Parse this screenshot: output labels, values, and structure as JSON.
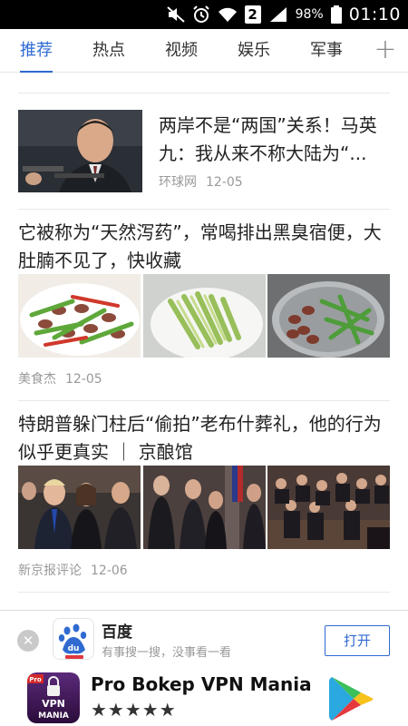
{
  "status_bar": {
    "battery": "98%",
    "time": "01:10",
    "notification_badge": "2"
  },
  "tabs": [
    {
      "label": "推荐",
      "active": true
    },
    {
      "label": "热点"
    },
    {
      "label": "视频"
    },
    {
      "label": "娱乐"
    },
    {
      "label": "军事"
    }
  ],
  "tab_add_icon": "plus-icon",
  "articles": [
    {
      "title": "两岸不是“两国”关系！马英九：我从来不称大陆为“...",
      "source": "环球网",
      "time": "12-05"
    },
    {
      "title": "它被称为“天然泻药”，常喝排出黑臭宿便，大肚腩不见了，快收藏",
      "source": "美食杰",
      "time": "12-05"
    },
    {
      "title": "特朗普躲门柱后“偷拍”老布什葬礼，他的行为似乎更真实 ｜ 京酿馆",
      "source": "新京报评论",
      "time": "12-06"
    }
  ],
  "ad_baidu": {
    "name": "百度",
    "description": "有事搜一搜，没事看一看",
    "open_label": "打开"
  },
  "ad_vpn": {
    "app_name": "Pro Bokep VPN Mania",
    "stars": "★★★★★",
    "icon_text_top": "VPN",
    "icon_text_bottom": "MANIA",
    "icon_badge": "Pro"
  },
  "colors": {
    "accent": "#2f6ad1",
    "meta_gray": "#999999"
  }
}
